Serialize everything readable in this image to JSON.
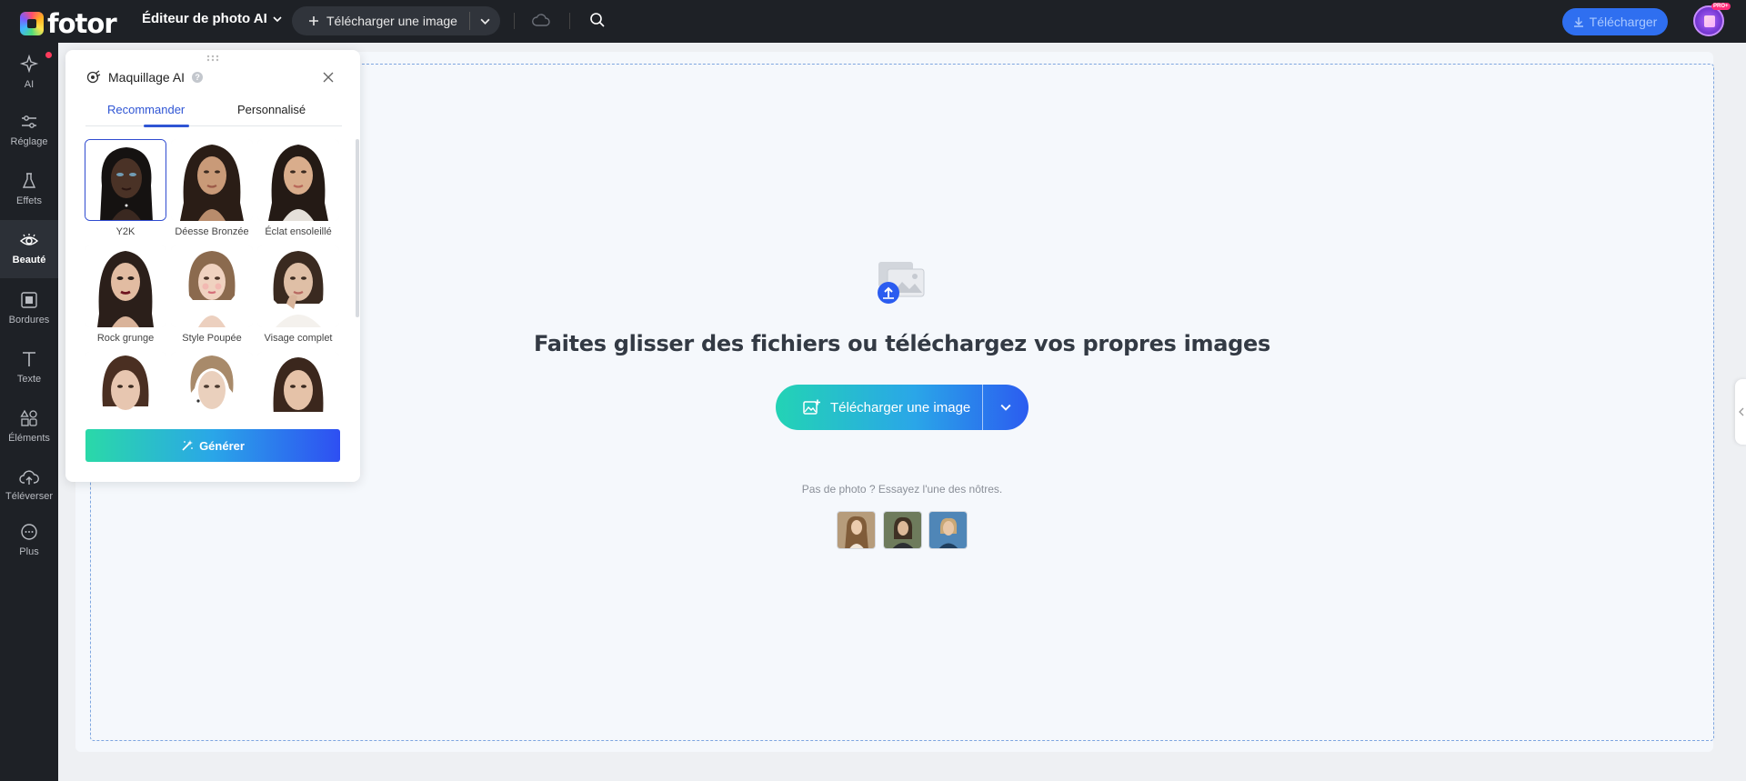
{
  "topbar": {
    "logo_text": "fotor",
    "editor_menu_label": "Éditeur de photo AI",
    "upload_label": "Télécharger une image",
    "download_label": "Télécharger",
    "pro_badge": "PRO+"
  },
  "sidebar": {
    "items": [
      {
        "label": "AI",
        "icon": "sparkle-icon"
      },
      {
        "label": "Réglage",
        "icon": "sliders-icon"
      },
      {
        "label": "Effets",
        "icon": "flask-icon"
      },
      {
        "label": "Beauté",
        "icon": "eye-icon"
      },
      {
        "label": "Bordures",
        "icon": "frame-icon"
      },
      {
        "label": "Texte",
        "icon": "text-icon"
      },
      {
        "label": "Éléments",
        "icon": "shapes-icon"
      },
      {
        "label": "Téléverser",
        "icon": "cloud-upload-icon"
      },
      {
        "label": "Plus",
        "icon": "more-icon"
      }
    ],
    "active": "Beauté"
  },
  "panel": {
    "title": "Maquillage AI",
    "tabs": [
      {
        "label": "Recommander",
        "active": true
      },
      {
        "label": "Personnalisé",
        "active": false
      }
    ],
    "styles": [
      {
        "label": "Y2K",
        "selected": true
      },
      {
        "label": "Déesse Bronzée"
      },
      {
        "label": "Éclat ensoleillé"
      },
      {
        "label": "Rock grunge"
      },
      {
        "label": "Style Poupée"
      },
      {
        "label": "Visage complet"
      },
      {
        "label": ""
      },
      {
        "label": ""
      },
      {
        "label": ""
      }
    ],
    "generate_label": "Générer"
  },
  "canvas": {
    "drop_title": "Faites glisser des fichiers ou téléchargez vos propres images",
    "upload_label": "Télécharger une image",
    "sample_prompt": "Pas de photo ? Essayez l'une des nôtres."
  },
  "colors": {
    "topbar_bg": "#1e2126",
    "accent_blue": "#2f55d4",
    "gradient_start": "#23d3b5",
    "gradient_end": "#2b5cf0",
    "download_bg": "#2f6ff0"
  }
}
